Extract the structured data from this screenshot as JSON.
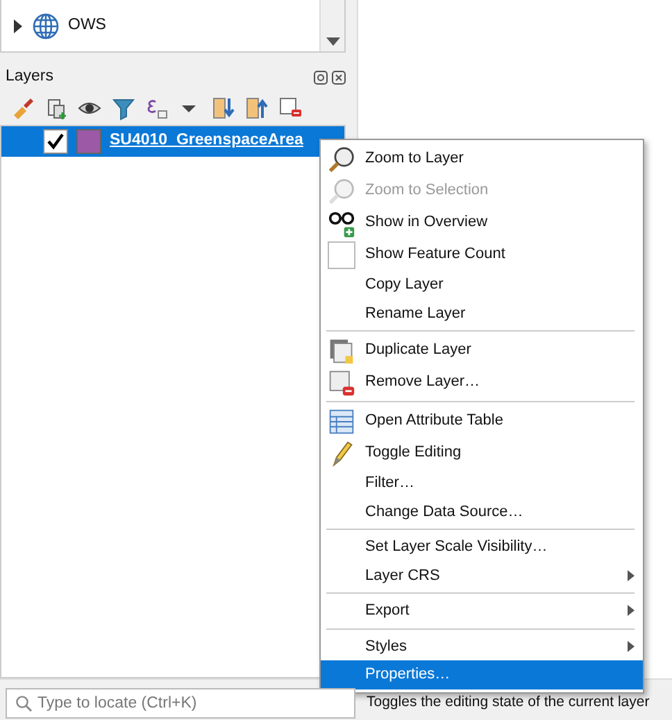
{
  "browser_panel": {
    "items": [
      {
        "label": "OWS",
        "expanded": false
      }
    ]
  },
  "layers_panel": {
    "title": "Layers",
    "layers": [
      {
        "name": "SU4010_GreenspaceArea",
        "checked": true,
        "selected": true,
        "color": "#9b59a6"
      }
    ]
  },
  "context_menu": {
    "items": [
      {
        "kind": "item",
        "label": "Zoom to Layer",
        "disabled": false,
        "selected": false
      },
      {
        "kind": "item",
        "label": "Zoom to Selection",
        "disabled": true,
        "selected": false
      },
      {
        "kind": "item",
        "label": "Show in Overview",
        "disabled": false,
        "selected": false
      },
      {
        "kind": "check",
        "label": "Show Feature Count",
        "checked": false,
        "disabled": false,
        "selected": false
      },
      {
        "kind": "item",
        "label": "Copy Layer",
        "disabled": false,
        "selected": false
      },
      {
        "kind": "item",
        "label": "Rename Layer",
        "disabled": false,
        "selected": false
      },
      {
        "kind": "separator"
      },
      {
        "kind": "item",
        "label": "Duplicate Layer",
        "disabled": false,
        "selected": false
      },
      {
        "kind": "item",
        "label": "Remove Layer…",
        "disabled": false,
        "selected": false
      },
      {
        "kind": "separator"
      },
      {
        "kind": "item",
        "label": "Open Attribute Table",
        "disabled": false,
        "selected": false
      },
      {
        "kind": "item",
        "label": "Toggle Editing",
        "disabled": false,
        "selected": false
      },
      {
        "kind": "item",
        "label": "Filter…",
        "disabled": false,
        "selected": false
      },
      {
        "kind": "item",
        "label": "Change Data Source…",
        "disabled": false,
        "selected": false
      },
      {
        "kind": "separator"
      },
      {
        "kind": "item",
        "label": "Set Layer Scale Visibility…",
        "disabled": false,
        "selected": false
      },
      {
        "kind": "submenu",
        "label": "Layer CRS",
        "disabled": false,
        "selected": false
      },
      {
        "kind": "separator"
      },
      {
        "kind": "submenu",
        "label": "Export",
        "disabled": false,
        "selected": false
      },
      {
        "kind": "separator"
      },
      {
        "kind": "submenu",
        "label": "Styles",
        "disabled": false,
        "selected": false
      },
      {
        "kind": "item",
        "label": "Properties…",
        "disabled": false,
        "selected": true
      }
    ]
  },
  "status_bar": {
    "search": {
      "placeholder": "Type to locate (Ctrl+K)"
    },
    "message": "Toggles the editing state of the current layer"
  }
}
